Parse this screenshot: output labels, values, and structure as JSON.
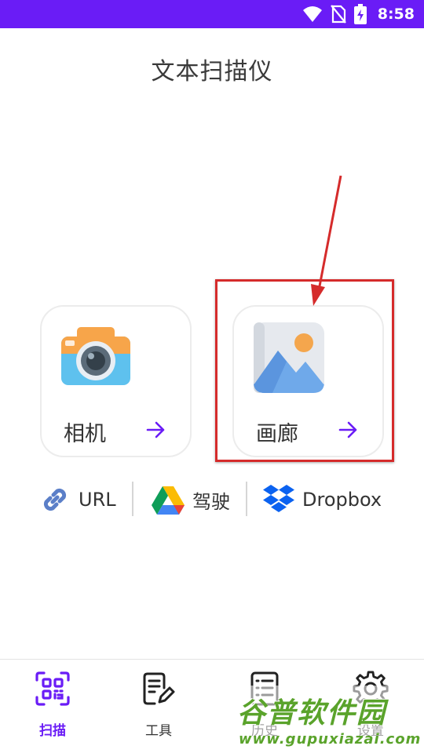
{
  "status_bar": {
    "time": "8:58",
    "icons": [
      "wifi-icon",
      "no-sim-icon",
      "battery-charging-icon"
    ]
  },
  "title": "文本扫描仪",
  "cards": [
    {
      "label": "相机",
      "icon": "camera-icon"
    },
    {
      "label": "画廊",
      "icon": "gallery-icon"
    }
  ],
  "sources": [
    {
      "label": "URL",
      "icon": "link-icon"
    },
    {
      "label": "驾驶",
      "icon": "google-drive-icon"
    },
    {
      "label": "Dropbox",
      "icon": "dropbox-icon"
    }
  ],
  "bottom_nav": [
    {
      "label": "扫描",
      "icon": "qr-scan-icon",
      "active": true
    },
    {
      "label": "工具",
      "icon": "edit-note-icon",
      "active": false
    },
    {
      "label": "历史",
      "icon": "history-list-icon",
      "active": false
    },
    {
      "label": "设置",
      "icon": "gear-icon",
      "active": false
    }
  ],
  "watermark": {
    "text": "谷普软件园",
    "url": "www.gupuxiazai.com"
  },
  "colors": {
    "accent": "#6a1cf6",
    "highlight": "#d52b2b",
    "watermark": "#5aa32b"
  }
}
